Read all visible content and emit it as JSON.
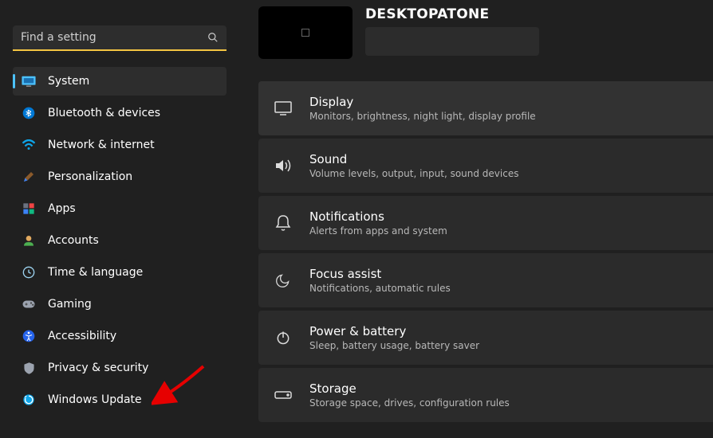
{
  "search": {
    "placeholder": "Find a setting"
  },
  "sidebar": {
    "items": [
      {
        "label": "System",
        "icon": "system",
        "active": true
      },
      {
        "label": "Bluetooth & devices",
        "icon": "bluetooth",
        "active": false
      },
      {
        "label": "Network & internet",
        "icon": "network",
        "active": false
      },
      {
        "label": "Personalization",
        "icon": "personalize",
        "active": false
      },
      {
        "label": "Apps",
        "icon": "apps",
        "active": false
      },
      {
        "label": "Accounts",
        "icon": "accounts",
        "active": false
      },
      {
        "label": "Time & language",
        "icon": "time",
        "active": false
      },
      {
        "label": "Gaming",
        "icon": "gaming",
        "active": false
      },
      {
        "label": "Accessibility",
        "icon": "accessibility",
        "active": false
      },
      {
        "label": "Privacy & security",
        "icon": "privacy",
        "active": false
      },
      {
        "label": "Windows Update",
        "icon": "update",
        "active": false
      }
    ]
  },
  "header": {
    "pc_name": "DESKTOPATONE"
  },
  "settings": [
    {
      "title": "Display",
      "sub": "Monitors, brightness, night light, display profile",
      "icon": "display"
    },
    {
      "title": "Sound",
      "sub": "Volume levels, output, input, sound devices",
      "icon": "sound"
    },
    {
      "title": "Notifications",
      "sub": "Alerts from apps and system",
      "icon": "notifications"
    },
    {
      "title": "Focus assist",
      "sub": "Notifications, automatic rules",
      "icon": "focus"
    },
    {
      "title": "Power & battery",
      "sub": "Sleep, battery usage, battery saver",
      "icon": "power"
    },
    {
      "title": "Storage",
      "sub": "Storage space, drives, configuration rules",
      "icon": "storage"
    }
  ]
}
